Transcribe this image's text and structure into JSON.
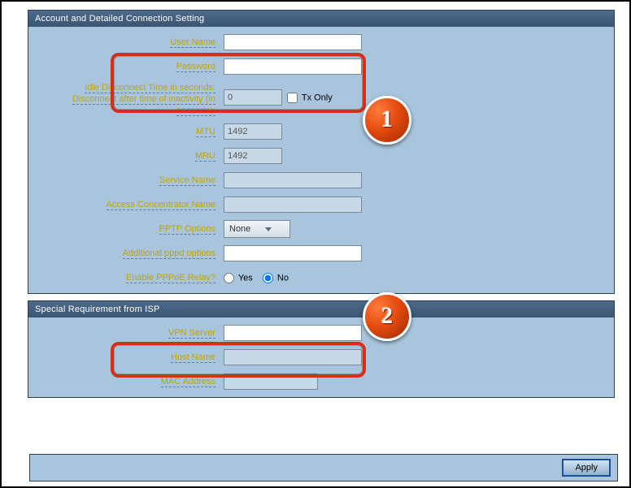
{
  "section1": {
    "title": "Account and Detailed Connection Setting",
    "labels": {
      "username": "User Name",
      "password": "Password",
      "idle1": "Idle Disconnect Time in seconds:",
      "idle2": "Disconnect after time of inactivity (in seconds):",
      "txonly": "Tx Only",
      "mtu": "MTU",
      "mru": "MRU",
      "service": "Service Name",
      "concentrator": "Access Concentrator Name",
      "pptp": "PPTP Options",
      "pppd": "Additional pppd options",
      "relay": "Enable PPPoE Relay?",
      "yes": "Yes",
      "no": "No"
    },
    "values": {
      "username": "",
      "password": "",
      "idle": "0",
      "mtu": "1492",
      "mru": "1492",
      "service": "",
      "concentrator": "",
      "pptp": "None",
      "pppd": ""
    }
  },
  "section2": {
    "title": "Special Requirement from ISP",
    "labels": {
      "vpn": "VPN Server",
      "host": "Host Name",
      "mac": "MAC Address"
    },
    "values": {
      "vpn": "",
      "host": "",
      "mac": ""
    }
  },
  "buttons": {
    "apply": "Apply"
  },
  "callouts": {
    "one": "1",
    "two": "2"
  }
}
